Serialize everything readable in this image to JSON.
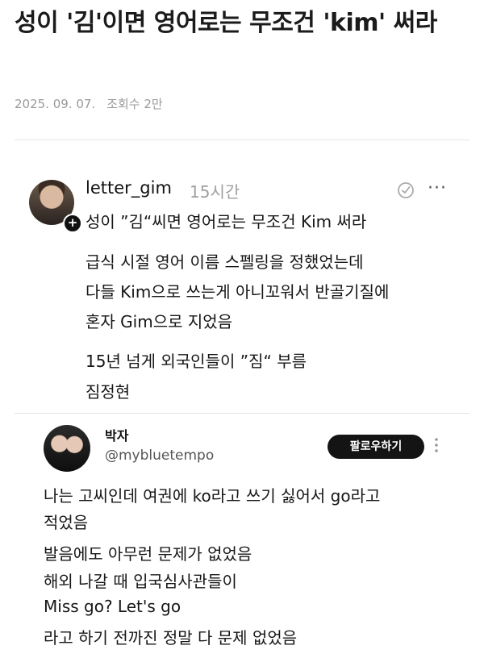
{
  "article": {
    "title": "성이 '김'이면 영어로는 무조건 'kim' 써라",
    "date": "2025. 09. 07.",
    "views": "조회수 2만"
  },
  "thread": {
    "username": "letter_gim",
    "time": "15시간",
    "lines": [
      "성이 ”김“씨면 영어로는 무조건 Kim 써라",
      "급식 시절 영어 이름 스펠링을 정했었는데",
      "다들 Kim으로 쓰는게 아니꼬워서 반골기질에",
      "혼자 Gim으로 지었음",
      "15년 넘게 외국인들이 ”짐“ 부름",
      "짐정현"
    ],
    "icons": {
      "avatar_plus": "+",
      "more": "···"
    }
  },
  "quote": {
    "name": "박자",
    "handle": "@mybluetempo",
    "follow_label": "팔로우하기",
    "lines": [
      "나는 고씨인데 여권에 ko라고 쓰기 싫어서 go라고",
      "적었음",
      "발음에도 아무런 문제가 없었음",
      "해외 나갈 때 입국심사관들이",
      "Miss go? Let's go",
      "라고 하기 전까진 정말 다 문제 없었음"
    ]
  }
}
